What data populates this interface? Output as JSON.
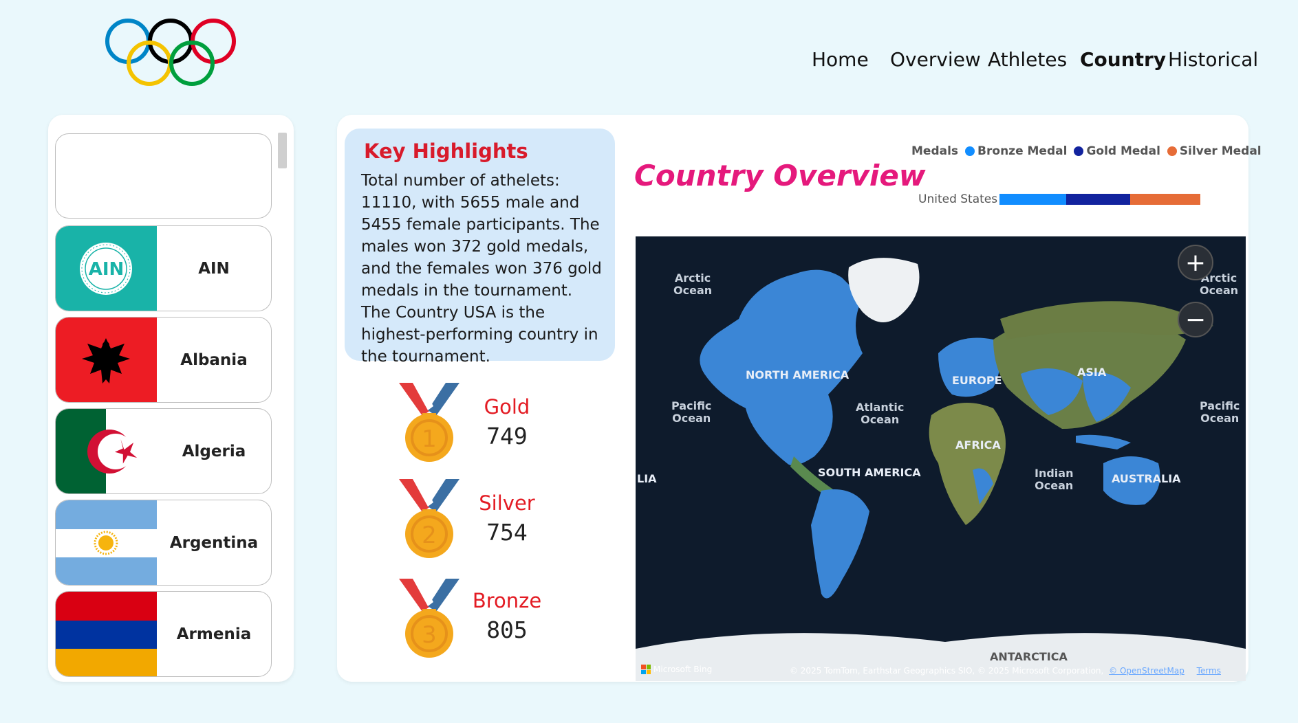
{
  "nav": {
    "items": [
      "Home",
      "Overview",
      "Athletes",
      "Country",
      "Historical"
    ],
    "active": "Country"
  },
  "sidebar": {
    "countries": [
      {
        "name": "AIN",
        "flag": "ain-emblem-icon"
      },
      {
        "name": "Albania",
        "flag": "albania-flag-icon"
      },
      {
        "name": "Algeria",
        "flag": "algeria-flag-icon"
      },
      {
        "name": "Argentina",
        "flag": "argentina-flag-icon"
      },
      {
        "name": "Armenia",
        "flag": "armenia-flag-icon"
      }
    ],
    "ain_badge_text": "AIN",
    "ain_badge_ring_text": "INDIVIDUAL NEUTRAL ATHLETES"
  },
  "highlights": {
    "title": "Key Highlights",
    "text": "Total number of athelets: 11110, with 5655 male and 5455 female participants. The males won 372 gold medals, and the females won 376 gold medals in the tournament. The Country USA is the highest-performing country in the tournament."
  },
  "medals": [
    {
      "label": "Gold",
      "value": "749",
      "number": "1"
    },
    {
      "label": "Silver",
      "value": "754",
      "number": "2"
    },
    {
      "label": "Bronze",
      "value": "805",
      "number": "3"
    }
  ],
  "overview": {
    "title": "Country Overview",
    "legend_title": "Medals",
    "legend": [
      {
        "name": "Bronze Medal",
        "color": "#118dff"
      },
      {
        "name": "Gold Medal",
        "color": "#12239e"
      },
      {
        "name": "Silver Medal",
        "color": "#e66c37"
      }
    ],
    "bar_country": "United States",
    "bar_values": [
      {
        "name": "Bronze Medal",
        "value": 42
      },
      {
        "name": "Gold Medal",
        "value": 40
      },
      {
        "name": "Silver Medal",
        "value": 44
      }
    ]
  },
  "map": {
    "oceans": [
      {
        "name": "Arctic\nOcean",
        "key": "arctic-left"
      },
      {
        "name": "Arctic\nOcean",
        "key": "arctic-right"
      },
      {
        "name": "Pacific\nOcean",
        "key": "pacific-left"
      },
      {
        "name": "Atlantic\nOcean",
        "key": "atlantic"
      },
      {
        "name": "Pacific\nOcean",
        "key": "pacific-right"
      },
      {
        "name": "Indian\nOcean",
        "key": "indian"
      }
    ],
    "continents": [
      "NORTH AMERICA",
      "EUROPE",
      "ASIA",
      "AFRICA",
      "SOUTH AMERICA",
      "AUSTRALIA",
      "ANTARCTICA",
      "LIA"
    ],
    "attribution": "© 2025 TomTom, Earthstar Geographics SIO, © 2025 Microsoft Corporation,",
    "osm_link": "© OpenStreetMap",
    "terms_link": "Terms",
    "provider": "Microsoft Bing"
  },
  "colors": {
    "background": "#eaf8fc",
    "highlight_box": "#d5e9fa",
    "accent_red": "#e31b23",
    "title_pink": "#e5197c",
    "land_highlight": "#3b86d6"
  }
}
